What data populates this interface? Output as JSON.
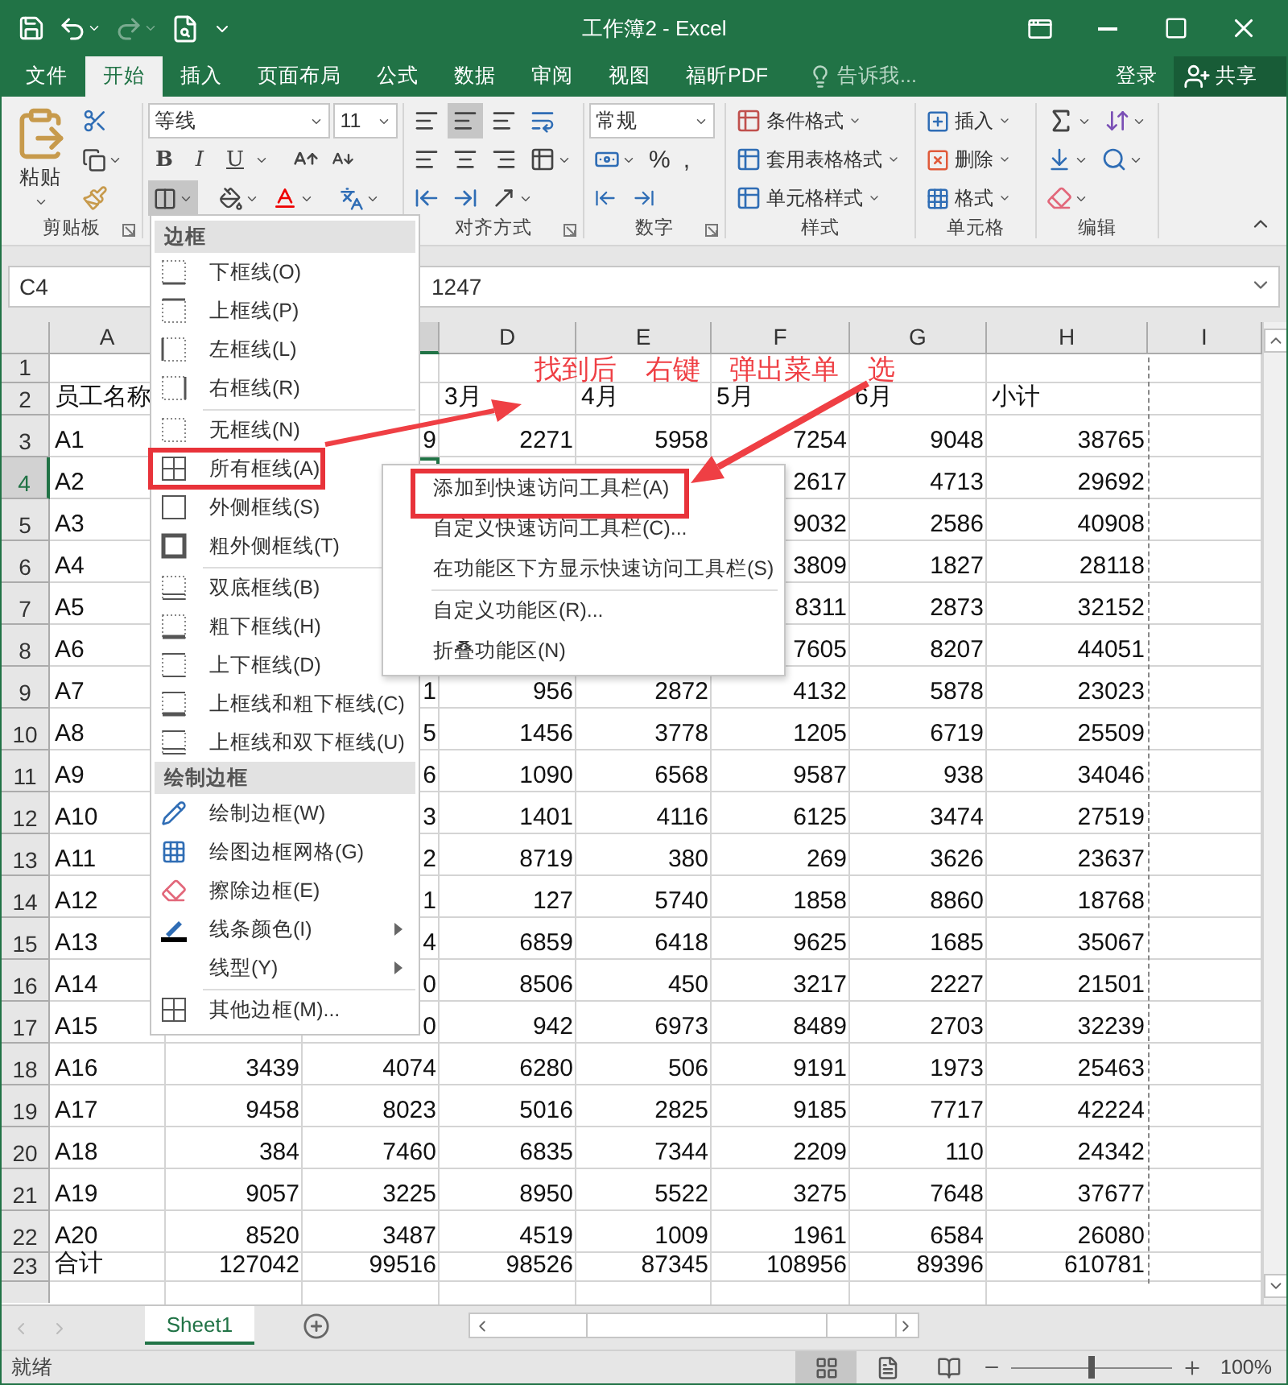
{
  "window": {
    "title": "工作簿2 - Excel",
    "redo_disabled": true
  },
  "tabs": [
    {
      "label": "文件",
      "selected": false
    },
    {
      "label": "开始",
      "selected": true
    },
    {
      "label": "插入",
      "selected": false
    },
    {
      "label": "页面布局",
      "selected": false
    },
    {
      "label": "公式",
      "selected": false
    },
    {
      "label": "数据",
      "selected": false
    },
    {
      "label": "审阅",
      "selected": false
    },
    {
      "label": "视图",
      "selected": false
    },
    {
      "label": "福昕PDF",
      "selected": false
    }
  ],
  "tell_me": {
    "placeholder": "告诉我..."
  },
  "account": {
    "sign_in": "登录",
    "share": "共享"
  },
  "ribbon": {
    "clipboard": {
      "label": "剪贴板",
      "paste": "粘贴"
    },
    "font": {
      "name": "等线",
      "size": "11",
      "styles": [
        "B",
        "I",
        "U"
      ],
      "border_expanded": true
    },
    "alignment": {
      "label": "对齐方式",
      "vertical": [
        {
          "selected": false
        },
        {
          "selected": true
        },
        {
          "selected": false
        }
      ]
    },
    "number": {
      "label": "数字",
      "format": "常规",
      "symbols": [
        "%",
        ","
      ]
    },
    "styles": {
      "label": "样式",
      "buttons": [
        "条件格式",
        "套用表格格式",
        "单元格样式"
      ]
    },
    "cells": {
      "label": "单元格",
      "buttons": [
        "插入",
        "删除",
        "格式"
      ]
    },
    "editing": {
      "label": "编辑"
    }
  },
  "formula_bar": {
    "name_box": "C4",
    "value": "1247"
  },
  "columns": [
    {
      "kind": "header",
      "label": "A",
      "selected": false
    },
    {
      "kind": "covered"
    },
    {
      "kind": "header",
      "selected": true
    },
    {
      "kind": "header",
      "label": "D",
      "selected": false
    },
    {
      "kind": "header",
      "label": "E",
      "selected": false
    },
    {
      "kind": "header",
      "label": "F",
      "selected": false
    },
    {
      "kind": "header",
      "label": "G",
      "selected": false
    },
    {
      "kind": "header",
      "label": "H",
      "selected": false
    },
    {
      "kind": "header",
      "label": "I",
      "selected": false
    }
  ],
  "rows": [
    {
      "header": "1",
      "kind": "blank",
      "selected": false,
      "cells": [
        null,
        null,
        null,
        null,
        null,
        null,
        null,
        null
      ]
    },
    {
      "header": "2",
      "kind": "labels",
      "selected": false,
      "cells": [
        "员工名称",
        null,
        null,
        "3月",
        "4月",
        "5月",
        "6月",
        "小计"
      ]
    },
    {
      "header": "3",
      "kind": "data",
      "selected": false,
      "cells": [
        "A1",
        null,
        "9",
        "2271",
        "5958",
        "7254",
        "9048",
        "38765"
      ]
    },
    {
      "header": "4",
      "kind": "data",
      "selected": true,
      "cells": [
        "A2",
        null,
        null,
        null,
        null,
        "2617",
        "4713",
        "29692"
      ]
    },
    {
      "header": "5",
      "kind": "data",
      "selected": false,
      "cells": [
        "A3",
        null,
        null,
        null,
        null,
        "9032",
        "2586",
        "40908"
      ]
    },
    {
      "header": "6",
      "kind": "data",
      "selected": false,
      "cells": [
        "A4",
        null,
        null,
        null,
        null,
        "3809",
        "1827",
        "28118"
      ]
    },
    {
      "header": "7",
      "kind": "data",
      "selected": false,
      "cells": [
        "A5",
        null,
        null,
        null,
        null,
        "8311",
        "2873",
        "32152"
      ]
    },
    {
      "header": "8",
      "kind": "data",
      "selected": false,
      "cells": [
        "A6",
        null,
        null,
        null,
        null,
        "7605",
        "8207",
        "44051"
      ]
    },
    {
      "header": "9",
      "kind": "data",
      "selected": false,
      "cells": [
        "A7",
        null,
        "1",
        "956",
        "2872",
        "4132",
        "5878",
        "23023"
      ]
    },
    {
      "header": "10",
      "kind": "data",
      "selected": false,
      "cells": [
        "A8",
        null,
        "5",
        "1456",
        "3778",
        "1205",
        "6719",
        "25509"
      ]
    },
    {
      "header": "11",
      "kind": "data",
      "selected": false,
      "cells": [
        "A9",
        null,
        "6",
        "1090",
        "6568",
        "9587",
        "938",
        "34046"
      ]
    },
    {
      "header": "12",
      "kind": "data",
      "selected": false,
      "cells": [
        "A10",
        null,
        "3",
        "1401",
        "4116",
        "6125",
        "3474",
        "27519"
      ]
    },
    {
      "header": "13",
      "kind": "data",
      "selected": false,
      "cells": [
        "A11",
        null,
        "2",
        "8719",
        "380",
        "269",
        "3626",
        "23637"
      ]
    },
    {
      "header": "14",
      "kind": "data",
      "selected": false,
      "cells": [
        "A12",
        null,
        "1",
        "127",
        "5740",
        "1858",
        "8860",
        "18768"
      ]
    },
    {
      "header": "15",
      "kind": "data",
      "selected": false,
      "cells": [
        "A13",
        null,
        "4",
        "6859",
        "6418",
        "9625",
        "1685",
        "35067"
      ]
    },
    {
      "header": "16",
      "kind": "data",
      "selected": false,
      "cells": [
        "A14",
        null,
        "0",
        "8506",
        "450",
        "3217",
        "2227",
        "21501"
      ]
    },
    {
      "header": "17",
      "kind": "data",
      "selected": false,
      "cells": [
        "A15",
        null,
        "0",
        "942",
        "6973",
        "8489",
        "2703",
        "32239"
      ]
    },
    {
      "header": "18",
      "kind": "data",
      "selected": false,
      "cells": [
        "A16",
        "3439",
        "4074",
        "6280",
        "506",
        "9191",
        "1973",
        "25463"
      ]
    },
    {
      "header": "19",
      "kind": "data",
      "selected": false,
      "cells": [
        "A17",
        "9458",
        "8023",
        "5016",
        "2825",
        "9185",
        "7717",
        "42224"
      ]
    },
    {
      "header": "20",
      "kind": "data",
      "selected": false,
      "cells": [
        "A18",
        "384",
        "7460",
        "6835",
        "7344",
        "2209",
        "110",
        "24342"
      ]
    },
    {
      "header": "21",
      "kind": "data",
      "selected": false,
      "cells": [
        "A19",
        "9057",
        "3225",
        "8950",
        "5522",
        "3275",
        "7648",
        "37677"
      ]
    },
    {
      "header": "22",
      "kind": "data",
      "selected": false,
      "cells": [
        "A20",
        "8520",
        "3487",
        "4519",
        "1009",
        "1961",
        "6584",
        "26080"
      ]
    },
    {
      "header": "23",
      "kind": "total",
      "selected": false,
      "cells": [
        "合计",
        "127042",
        "99516",
        "98526",
        "87345",
        "108956",
        "89396",
        "610781"
      ]
    }
  ],
  "border_menu": [
    {
      "kind": "heading",
      "label": "边框"
    },
    {
      "kind": "item",
      "label": "下框线(O)",
      "submenu": false
    },
    {
      "kind": "item",
      "label": "上框线(P)",
      "submenu": false
    },
    {
      "kind": "item",
      "label": "左框线(L)",
      "submenu": false
    },
    {
      "kind": "item",
      "label": "右框线(R)",
      "submenu": false
    },
    {
      "kind": "divider"
    },
    {
      "kind": "item",
      "label": "无框线(N)",
      "submenu": false
    },
    {
      "kind": "item",
      "label": "所有框线(A)",
      "submenu": false
    },
    {
      "kind": "item",
      "label": "外侧框线(S)",
      "submenu": false
    },
    {
      "kind": "item",
      "label": "粗外侧框线(T)",
      "submenu": false
    },
    {
      "kind": "divider"
    },
    {
      "kind": "item",
      "label": "双底框线(B)",
      "submenu": false
    },
    {
      "kind": "item",
      "label": "粗下框线(H)",
      "submenu": false
    },
    {
      "kind": "item",
      "label": "上下框线(D)",
      "submenu": false
    },
    {
      "kind": "item",
      "label": "上框线和粗下框线(C)",
      "submenu": false
    },
    {
      "kind": "item",
      "label": "上框线和双下框线(U)",
      "submenu": false
    },
    {
      "kind": "heading",
      "label": "绘制边框"
    },
    {
      "kind": "item",
      "label": "绘制边框(W)",
      "submenu": false
    },
    {
      "kind": "item",
      "label": "绘图边框网格(G)",
      "submenu": false
    },
    {
      "kind": "item",
      "label": "擦除边框(E)",
      "submenu": false
    },
    {
      "kind": "item",
      "label": "线条颜色(I)",
      "submenu": true
    },
    {
      "kind": "item",
      "label": "线型(Y)",
      "submenu": true
    },
    {
      "kind": "divider"
    },
    {
      "kind": "item",
      "label": "其他边框(M)...",
      "submenu": false
    }
  ],
  "context_menu": [
    {
      "kind": "item",
      "label": "添加到快速访问工具栏(A)"
    },
    {
      "kind": "item",
      "label": "自定义快速访问工具栏(C)..."
    },
    {
      "kind": "item",
      "label": "在功能区下方显示快速访问工具栏(S)"
    },
    {
      "kind": "divider"
    },
    {
      "kind": "item",
      "label": "自定义功能区(R)..."
    },
    {
      "kind": "item",
      "label": "折叠功能区(N)"
    }
  ],
  "annotation": {
    "words": [
      "找到后",
      "右键",
      "弹出菜单",
      "选"
    ]
  },
  "sheets": [
    {
      "label": "Sheet1",
      "selected": true
    }
  ],
  "status_bar": {
    "text": "就绪",
    "zoom": "100%",
    "level": 0.5
  }
}
